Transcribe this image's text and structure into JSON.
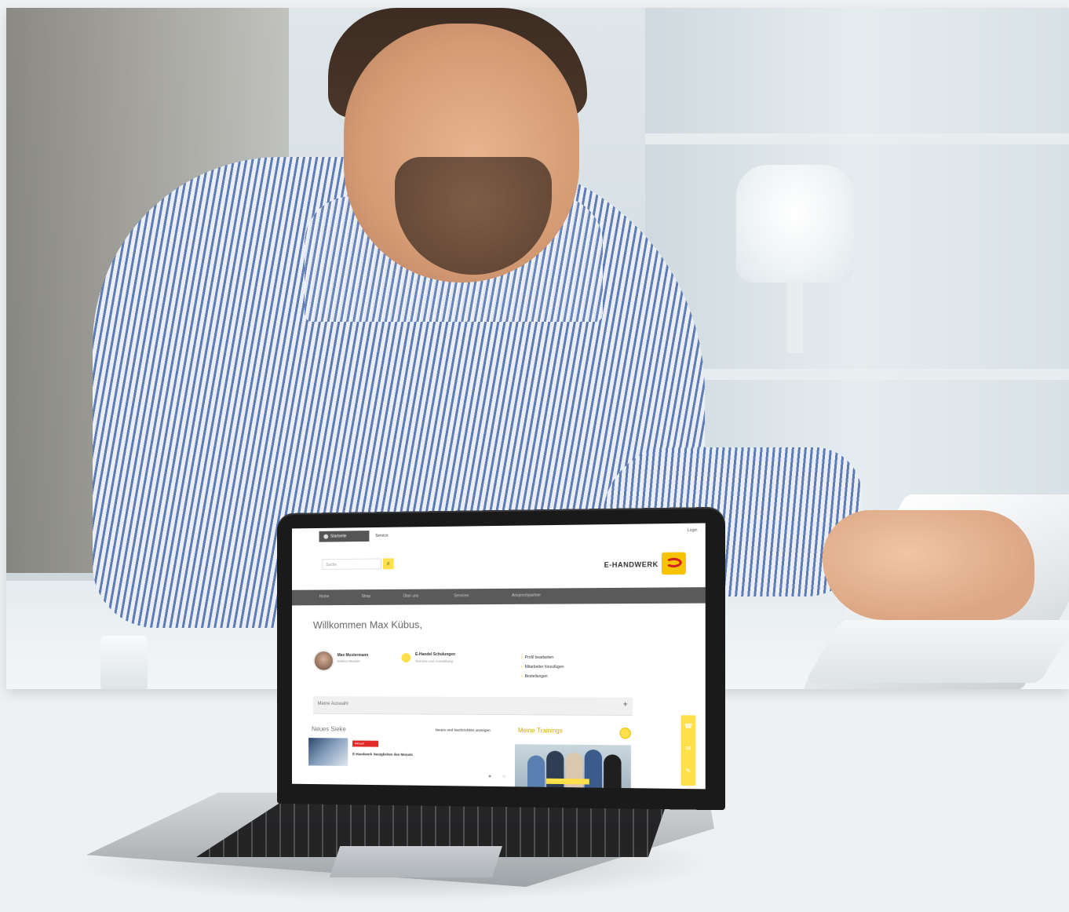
{
  "website": {
    "tabs": [
      {
        "label": "Startseite"
      },
      {
        "label": "Service"
      }
    ],
    "login_link": "Login",
    "search": {
      "placeholder": "Suche",
      "button_icon": "search-icon"
    },
    "logo": {
      "text": "E-HANDWERK",
      "mark": "e-handwerk-logo"
    },
    "nav": [
      {
        "label": "Home"
      },
      {
        "label": "Shop"
      },
      {
        "label": "Über uns"
      },
      {
        "label": "Services"
      },
      {
        "label": "Ansprechpartner"
      }
    ],
    "welcome_heading": "Willkommen Max Kübus,",
    "intro_text": "",
    "profile": {
      "name": "Max Mustermann",
      "role": "Elektro-Meister"
    },
    "notice": {
      "title": "E-Handel Schulungen",
      "subtitle": "Termine und Anmeldung"
    },
    "quicklinks": [
      {
        "label": "Profil bearbeiten"
      },
      {
        "label": "Mitarbeiter hinzufügen"
      },
      {
        "label": "Bestellungen"
      }
    ],
    "accordion": {
      "label": "Meine Auswahl",
      "toggle": "+"
    },
    "news": {
      "heading": "Neues Sieke",
      "all_link": "Neues und Nachrichten anzeigen",
      "badge": "Aktuell",
      "meta": "",
      "title": "E-Handwerk Neuigkeiten des Monats",
      "pager": "● ○"
    },
    "trainings": {
      "heading": "Meine Trainings"
    },
    "side_contact": [
      "phone-icon",
      "mail-icon",
      "chat-icon"
    ]
  },
  "colors": {
    "accent_yellow": "#ffe04a",
    "nav_gray": "#5a5a5a",
    "badge_red": "#e12a2a",
    "logo_red": "#d31f1f"
  }
}
